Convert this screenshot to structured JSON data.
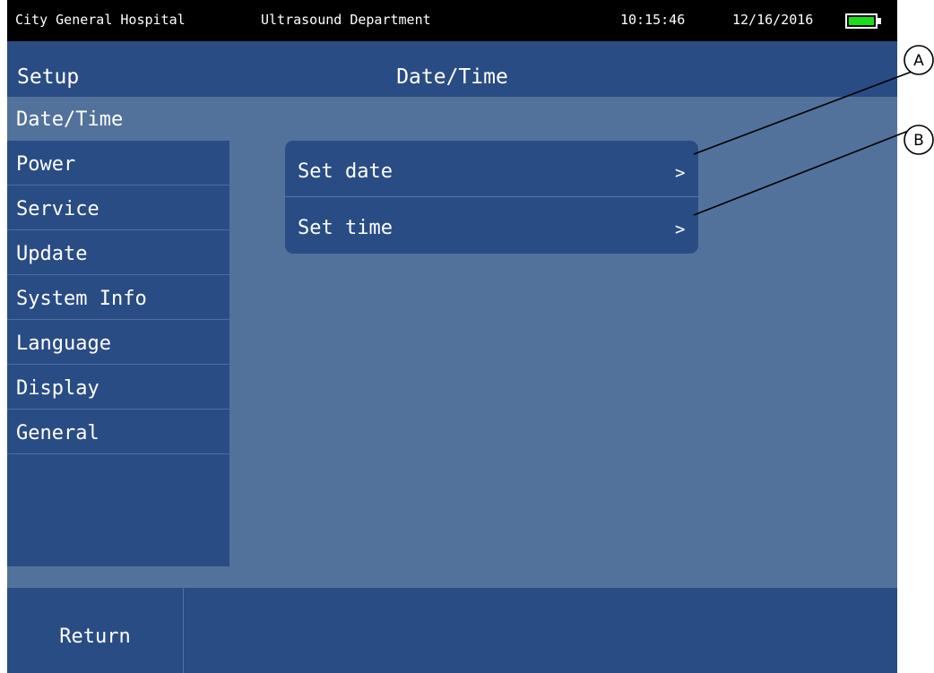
{
  "status_bar": {
    "hospital": "City General Hospital",
    "department": "Ultrasound Department",
    "time": "10:15:46",
    "date": "12/16/2016",
    "battery_level": 1.0,
    "battery_color": "#18e018"
  },
  "header": {
    "section": "Setup",
    "title": "Date/Time"
  },
  "sidebar": {
    "items": [
      {
        "label": "Date/Time",
        "active": true
      },
      {
        "label": "Power",
        "active": false
      },
      {
        "label": "Service",
        "active": false
      },
      {
        "label": "Update",
        "active": false
      },
      {
        "label": "System Info",
        "active": false
      },
      {
        "label": "Language",
        "active": false
      },
      {
        "label": "Display",
        "active": false
      },
      {
        "label": "General",
        "active": false
      }
    ]
  },
  "panel": {
    "rows": [
      {
        "label": "Set date",
        "chevron": ">"
      },
      {
        "label": "Set time",
        "chevron": ">"
      }
    ]
  },
  "bottom_bar": {
    "return_label": "Return"
  },
  "callouts": {
    "a": "A",
    "b": "B"
  },
  "colors": {
    "background": "#52729c",
    "panel": "#2a4c84",
    "status_bar": "#000000",
    "text": "#ffffff"
  }
}
